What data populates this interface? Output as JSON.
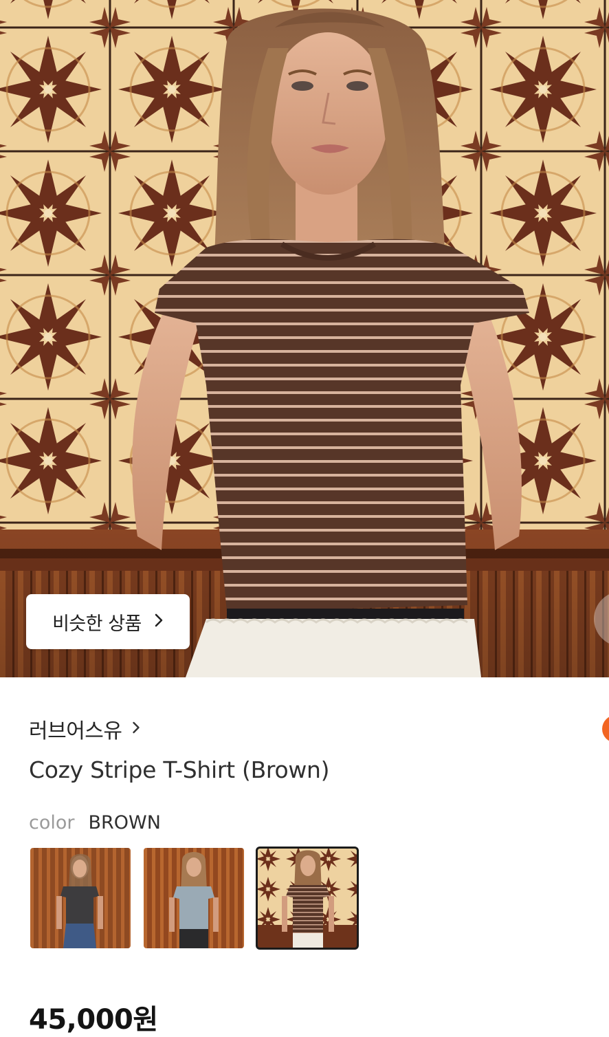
{
  "hero": {
    "similar_button_label": "비슷한 상품"
  },
  "product": {
    "brand": "러브어스유",
    "name": "Cozy Stripe T-Shirt (Brown)",
    "color_key": "color",
    "color_value": "BROWN",
    "price": "45,000원",
    "thumbnails": [
      {
        "variant": "charcoal",
        "selected": false
      },
      {
        "variant": "blue-grey",
        "selected": false
      },
      {
        "variant": "brown-stripe",
        "selected": true
      }
    ]
  },
  "icons": {
    "similar_chevron": "chevron-right-icon",
    "brand_chevron": "chevron-right-icon"
  },
  "colors": {
    "accent_orange": "#f26522",
    "tile_cream": "#f1d7a6",
    "tile_brown": "#6e3220",
    "wood": "#7a3b1e",
    "shirt_brown": "#5a3a2e"
  }
}
